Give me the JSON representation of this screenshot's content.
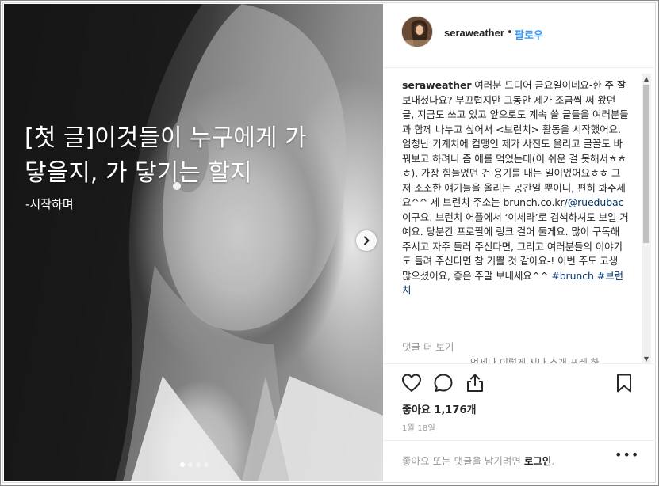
{
  "post": {
    "overlay_line1": "[첫 글]이것들이 누구에게 가",
    "overlay_line2": "닿을지, 가 닿기는 할지",
    "overlay_sub": "-시작하며",
    "carousel_total": 4,
    "carousel_active": 1
  },
  "header": {
    "username": "seraweather",
    "separator": "•",
    "follow_label": "팔로우"
  },
  "caption": {
    "username": "seraweather",
    "text_before_mention": "여러분 드디어 금요일이네요-한 주 잘 보내셨나요? 부끄럽지만 그동안 제가 조금씩 써 왔던 글, 지금도 쓰고 있고 앞으로도 계속 쓸 글들을 여러분들과 함께 나누고 싶어서 <브런치> 활동을 시작했어요. 엄청난 기계치에 컴맹인 제가 사진도 올리고 글꼴도 바꿔보고 하려니 좀 애를 먹었는데(이 쉬운 걸 못해서ㅎㅎㅎ), 가장 힘들었던 건 용기를 내는 일이었어요ㅎㅎ 그저 소소한 얘기들을 올리는 공간일 뿐이니, 편히 봐주세요^^ 제 브런치 주소는 brunch.co.kr/",
    "mention": "@ruedubac",
    "text_after_mention": " 이구요. 브런치 어플에서 ‘이세라’로 검색하셔도 보일 거예요. 당분간 프로필에 링크 걸어 둘게요. 많이 구독해 주시고 자주 들러 주신다면, 그리고 여러분들의 이야기도 들려 주신다면 참 기쁠 것 같아요-! 이번 주도 고생 많으셨어요, 좋은 주말 보내세요^^ ",
    "hashtag1": "#brunch",
    "hashtag2": "#브런치"
  },
  "comments": {
    "load_more": "댓글 더 보기",
    "partial_line": "언제나 이렇게 시나 소개 포레 하"
  },
  "actions": {
    "icons": [
      "heart-icon",
      "comment-icon",
      "share-icon",
      "bookmark-icon"
    ]
  },
  "likes": {
    "label": "좋아요 1,176개"
  },
  "date": {
    "label": "1월 18일"
  },
  "footer": {
    "prompt": "좋아요 또는 댓글을 남기려면 ",
    "login": "로그인",
    "period": ".",
    "more": "•••"
  },
  "colors": {
    "link_blue": "#3897f0",
    "hashtag_blue": "#003569",
    "muted": "#999999",
    "text": "#262626"
  }
}
